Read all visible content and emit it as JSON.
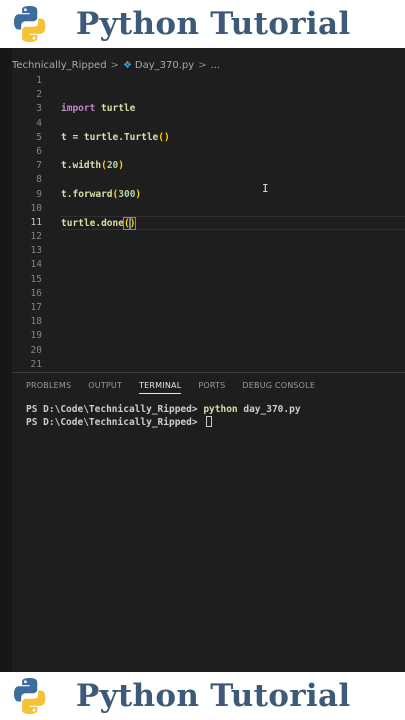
{
  "banner": {
    "title": "Python Tutorial",
    "logo_icon": "python-logo-icon",
    "title_color": "#3d5a78"
  },
  "breadcrumb": {
    "folder": "Technically_Ripped",
    "file": "Day_370.py",
    "more": "..."
  },
  "editor": {
    "line_numbers": [
      "1",
      "2",
      "3",
      "4",
      "5",
      "6",
      "7",
      "8",
      "9",
      "10",
      "11",
      "12",
      "13",
      "14",
      "15",
      "16",
      "17",
      "18",
      "19",
      "20",
      "21"
    ],
    "active_line": "11",
    "lines": {
      "l3_kw": "import",
      "l3_mod": " turtle",
      "l5_a": "t = ",
      "l5_b": "turtle",
      "l5_c": ".",
      "l5_d": "Turtle",
      "l5_e": "()",
      "l7_a": "t",
      "l7_b": ".",
      "l7_c": "width",
      "l7_d": "(",
      "l7_e": "20",
      "l7_f": ")",
      "l9_a": "t",
      "l9_b": ".",
      "l9_c": "forward",
      "l9_d": "(",
      "l9_e": "300",
      "l9_f": ")",
      "l11_a": "turtle",
      "l11_b": ".",
      "l11_c": "done",
      "l11_d": "(",
      "l11_e": ")"
    }
  },
  "panel": {
    "tabs": [
      "PROBLEMS",
      "OUTPUT",
      "TERMINAL",
      "PORTS",
      "DEBUG CONSOLE"
    ],
    "active_tab": "TERMINAL",
    "terminal": {
      "line1_prompt": "PS D:\\Code\\Technically_Ripped> ",
      "line1_cmd": "python",
      "line1_arg": " day_370.py",
      "line2_prompt": "PS D:\\Code\\Technically_Ripped> "
    }
  }
}
